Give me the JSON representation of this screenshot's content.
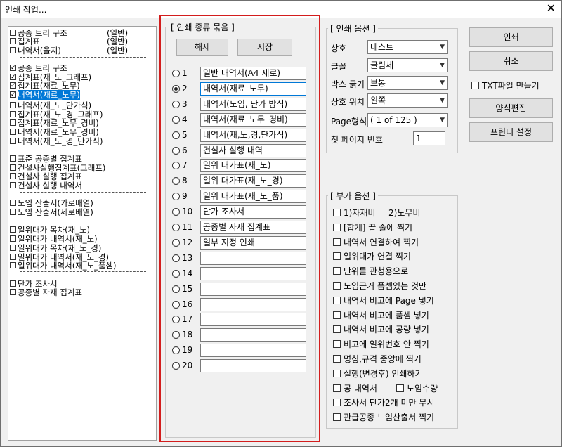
{
  "window": {
    "title": "인쇄 작업..."
  },
  "left_list": [
    {
      "text": "공종 트리 구조",
      "right": "(일반)",
      "checked": false
    },
    {
      "text": "집계표",
      "right": "(일반)",
      "checked": false
    },
    {
      "text": "내역서(을지)",
      "right": "(일반)",
      "checked": false
    },
    {
      "text": "공종 트리 구조",
      "right": "",
      "checked": true
    },
    {
      "text": "집계표(재_노_그래프)",
      "right": "",
      "checked": true
    },
    {
      "text": "집계표(재료_노무)",
      "right": "",
      "checked": true
    },
    {
      "text": "내역서(재료_노무)",
      "right": "",
      "checked": true,
      "selected": true
    },
    {
      "text": "내역서(재_노_단가식)",
      "right": "",
      "checked": false
    },
    {
      "text": "집계표(재_노_경_그래프)",
      "right": "",
      "checked": false
    },
    {
      "text": "집계표(재료_노무_경비)",
      "right": "",
      "checked": false
    },
    {
      "text": "내역서(재료_노무_경비)",
      "right": "",
      "checked": false
    },
    {
      "text": "내역서(재_노_경_단가식)",
      "right": "",
      "checked": false
    },
    {
      "text": "표준 공종별 집계표",
      "right": "",
      "checked": false
    },
    {
      "text": "건설사실행집계표(그래프)",
      "right": "",
      "checked": false
    },
    {
      "text": "건설사 실행 집계표",
      "right": "",
      "checked": false
    },
    {
      "text": "건설사 실행 내역서",
      "right": "",
      "checked": false
    },
    {
      "text": "노임 산출서(가로배열)",
      "right": "",
      "checked": false
    },
    {
      "text": "노임 산출서(세로배열)",
      "right": "",
      "checked": false
    },
    {
      "text": "일위대가 목차(재_노)",
      "right": "",
      "checked": false
    },
    {
      "text": "일위대가 내역서(재_노)",
      "right": "",
      "checked": false
    },
    {
      "text": "일위대가 목차(재_노_경)",
      "right": "",
      "checked": false
    },
    {
      "text": "일위대가 내역서(재_노_경)",
      "right": "",
      "checked": false
    },
    {
      "text": "일위대가 내역서(재_노_품셈)",
      "right": "",
      "checked": false
    },
    {
      "text": "단가 조사서",
      "right": "",
      "checked": false
    },
    {
      "text": "공종별 자재 집계표",
      "right": "",
      "checked": false
    }
  ],
  "print_group": {
    "title": "[ 인쇄 종류 묶음 ]",
    "release_label": "해제",
    "save_label": "저장",
    "slots": [
      {
        "num": "1",
        "value": "일반 내역서(A4 세로)"
      },
      {
        "num": "2",
        "value": "내역서(재료_노무)",
        "selected": true
      },
      {
        "num": "3",
        "value": "내역서(노임, 단가 방식)"
      },
      {
        "num": "4",
        "value": "내역서(재료_노무_경비)"
      },
      {
        "num": "5",
        "value": "내역서(재,노,경,단가식)"
      },
      {
        "num": "6",
        "value": "건설사 실행 내역"
      },
      {
        "num": "7",
        "value": "일위 대가표(재_노)"
      },
      {
        "num": "8",
        "value": "일위 대가표(재_노_경)"
      },
      {
        "num": "9",
        "value": "일위 대가표(재_노_품)"
      },
      {
        "num": "10",
        "value": "단가 조사서"
      },
      {
        "num": "11",
        "value": "공종별 자재 집계표"
      },
      {
        "num": "12",
        "value": "일부 지정 인쇄"
      },
      {
        "num": "13",
        "value": ""
      },
      {
        "num": "14",
        "value": ""
      },
      {
        "num": "15",
        "value": ""
      },
      {
        "num": "16",
        "value": ""
      },
      {
        "num": "17",
        "value": ""
      },
      {
        "num": "18",
        "value": ""
      },
      {
        "num": "19",
        "value": ""
      },
      {
        "num": "20",
        "value": ""
      }
    ]
  },
  "print_options": {
    "title": "[ 인쇄 옵션 ]",
    "fields": [
      {
        "label": "상호",
        "value": "테스트"
      },
      {
        "label": "글꼴",
        "value": "굴림체"
      },
      {
        "label": "박스 굵기",
        "value": "보통"
      },
      {
        "label": "상호 위치",
        "value": "왼쪽"
      },
      {
        "label": "Page형식",
        "value": "( 1 of 125 )"
      }
    ],
    "first_page_label": "첫 페이지 번호",
    "first_page_value": "1"
  },
  "buttons": {
    "print": "인쇄",
    "cancel": "취소",
    "txt_label": "TXT파일 만들기",
    "form_edit": "양식편집",
    "printer_setup": "프린터 설정"
  },
  "extra_options": {
    "title": "[ 부가 옵션 ]",
    "items": [
      {
        "text": "1)자재비",
        "text2": "2)노무비"
      },
      {
        "text": "[합계] 끝 줄에 찍기"
      },
      {
        "text": "내역서 연결하여 찍기"
      },
      {
        "text": "일위대가 연결 찍기"
      },
      {
        "text": "단위를 관청용으로"
      },
      {
        "text": "노임근거 품셈있는 것만"
      },
      {
        "text": "내역서 비고에 Page 넣기"
      },
      {
        "text": "내역서 비고에 품셈 넣기"
      },
      {
        "text": "내역서 비고에 공량 넣기"
      },
      {
        "text": "비고에 일위번호 안 찍기"
      },
      {
        "text": "명칭,규격 중앙에 찍기"
      },
      {
        "text": "실행(변경후) 인쇄하기"
      },
      {
        "text": "공 내역서",
        "text2": "노임수량"
      },
      {
        "text": "조사서 단가2개 미만 무시"
      },
      {
        "text": "관급공종 노임산출서 찍기"
      }
    ]
  }
}
